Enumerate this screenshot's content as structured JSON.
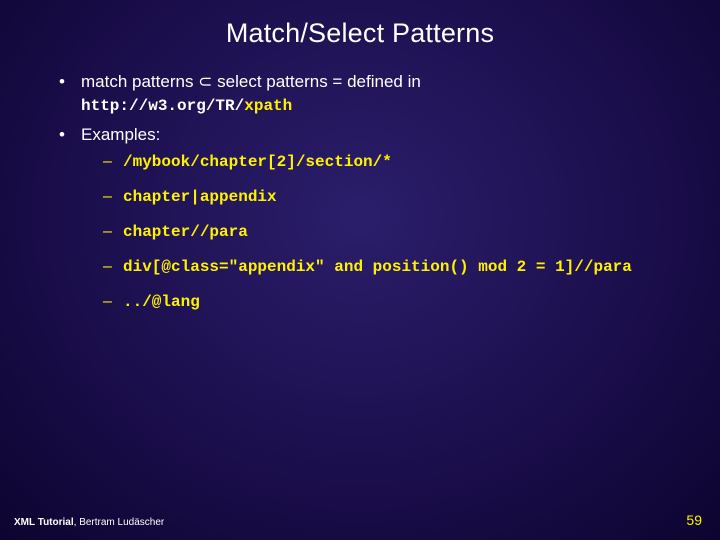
{
  "title": "Match/Select Patterns",
  "bullets": {
    "match_text_pre": "match patterns ",
    "subset_symbol": "⊂",
    "match_text_post": " select patterns = defined in",
    "url_base": "http://w3.org/TR/",
    "url_tail": "xpath",
    "examples_label": "Examples:"
  },
  "examples": [
    "/mybook/chapter[2]/section/*",
    "chapter|appendix",
    "chapter//para",
    "div[@class=\"appendix\" and position() mod 2 = 1]//para",
    "../@lang"
  ],
  "footer": {
    "tutorial": "XML Tutorial",
    "author": ", Bertram Ludäscher",
    "page": "59"
  }
}
